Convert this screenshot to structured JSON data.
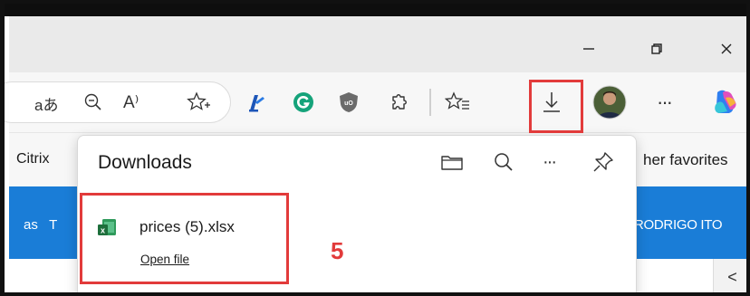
{
  "window": {
    "minimize_icon": "minimize-icon",
    "restore_icon": "restore-icon",
    "close_icon": "close-icon"
  },
  "toolbar": {
    "read_aloud_text": "aあ",
    "zoom_icon": "zoom-out-icon",
    "immersive_reader_text": "A⁾",
    "favorite_icon": "star-add-icon",
    "extensions": [
      "pen-extension-icon",
      "grammarly-icon",
      "ublock-icon"
    ],
    "extensions_puzzle_icon": "puzzle-icon",
    "favorites_icon": "favorites-icon",
    "downloads_icon": "download-icon",
    "more_label": "···",
    "copilot_icon": "copilot-icon"
  },
  "favorites_bar": {
    "left_item": "Citrix",
    "right_item": "her favorites"
  },
  "site_header": {
    "left_text": "as   T",
    "user_name": "RODRIGO ITO",
    "collapse_label": "<"
  },
  "downloads": {
    "title": "Downloads",
    "more_label": "···",
    "items": [
      {
        "file_name": "prices (5).xlsx",
        "action_label": "Open file"
      }
    ]
  },
  "annotation": {
    "step_number": "5"
  },
  "colors": {
    "accent_blue": "#1a7dd7",
    "highlight_red": "#e23b3b"
  }
}
